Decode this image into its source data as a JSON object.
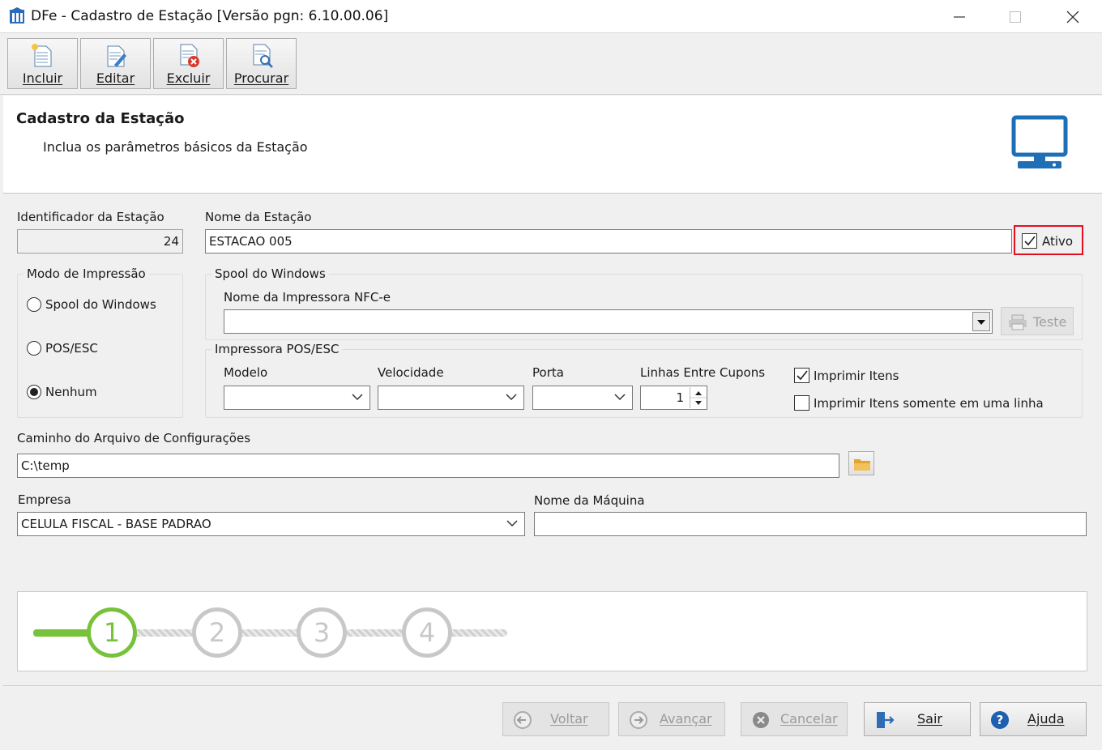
{
  "window": {
    "title": "DFe - Cadastro de Estação [Versão pgn: 6.10.00.06]"
  },
  "toolbar": [
    {
      "label": "Incluir",
      "icon": "new-document-icon"
    },
    {
      "label": "Editar",
      "icon": "edit-document-icon"
    },
    {
      "label": "Excluir",
      "icon": "delete-document-icon"
    },
    {
      "label": "Procurar",
      "icon": "search-document-icon"
    }
  ],
  "header": {
    "title": "Cadastro da Estação",
    "subtitle": "Inclua os parâmetros básicos da Estação",
    "icon": "monitor-icon",
    "icon_color": "#1e6fb5"
  },
  "form": {
    "id_label": "Identificador da Estação",
    "id_value": "24",
    "name_label": "Nome da Estação",
    "name_value": "ESTACAO 005",
    "active_label": "Ativo",
    "active_checked": true,
    "active_highlight_color": "#e01020",
    "print_mode": {
      "legend": "Modo de Impressão",
      "options": [
        "Spool do Windows",
        "POS/ESC",
        "Nenhum"
      ],
      "selected": "Nenhum"
    },
    "spool": {
      "legend": "Spool do Windows",
      "printer_label": "Nome da Impressora NFC-e",
      "printer_value": "",
      "test_label": "Teste"
    },
    "pos": {
      "legend": "Impressora POS/ESC",
      "model_label": "Modelo",
      "model_value": "",
      "speed_label": "Velocidade",
      "speed_value": "",
      "port_label": "Porta",
      "port_value": "",
      "lines_label": "Linhas Entre Cupons",
      "lines_value": "1",
      "print_items_label": "Imprimir Itens",
      "print_items_checked": true,
      "print_single_line_label": "Imprimir Itens somente em uma linha",
      "print_single_line_checked": false
    },
    "config_path_label": "Caminho do Arquivo de Configurações",
    "config_path_value": "C:\\temp",
    "company_label": "Empresa",
    "company_value": "CELULA FISCAL - BASE PADRAO",
    "machine_label": "Nome da Máquina",
    "machine_value": ""
  },
  "wizard": {
    "steps": [
      "1",
      "2",
      "3",
      "4"
    ],
    "current": 1,
    "active_color": "#78c23b"
  },
  "footer": [
    {
      "label": "Voltar",
      "enabled": false,
      "icon": "back-arrow-icon"
    },
    {
      "label": "Avançar",
      "enabled": false,
      "icon": "forward-arrow-icon"
    },
    {
      "label": "Cancelar",
      "enabled": false,
      "icon": "cancel-icon"
    },
    {
      "label": "Sair",
      "enabled": true,
      "icon": "exit-icon"
    },
    {
      "label": "Ajuda",
      "enabled": true,
      "icon": "help-icon"
    }
  ]
}
